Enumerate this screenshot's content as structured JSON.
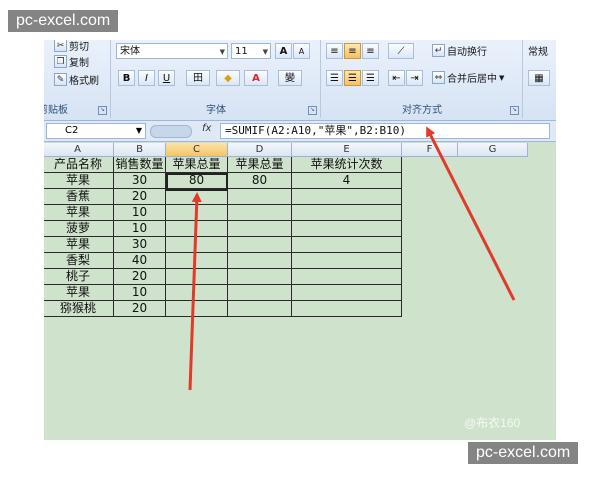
{
  "watermark": "pc-excel.com",
  "credit": "@布衣160",
  "ribbon": {
    "clipboard": {
      "cut": "剪切",
      "copy": "复制",
      "format_painter": "格式刷",
      "label": "剪贴板"
    },
    "font": {
      "name": "宋体",
      "size": "11",
      "grow": "A",
      "shrink": "A",
      "bold": "B",
      "italic": "I",
      "underline": "U",
      "border_icon": "田",
      "fill_icon": "◆",
      "color_icon": "A",
      "phonetic": "變",
      "label": "字体"
    },
    "alignment": {
      "wrap_text": "自动换行",
      "merge_center": "合并后居中",
      "label": "对齐方式"
    },
    "number": {
      "format": "常规"
    }
  },
  "formula_bar": {
    "name_box": "C2",
    "fx": "fx",
    "formula": "=SUMIF(A2:A10,\"苹果\",B2:B10)"
  },
  "columns": [
    "A",
    "B",
    "C",
    "D",
    "E",
    "F",
    "G"
  ],
  "table": {
    "headers": [
      "产品名称",
      "销售数量",
      "苹果总量",
      "苹果总量",
      "苹果统计次数"
    ],
    "rows": [
      [
        "苹果",
        "30",
        "80",
        "80",
        "4"
      ],
      [
        "香蕉",
        "20",
        "",
        "",
        ""
      ],
      [
        "苹果",
        "10",
        "",
        "",
        ""
      ],
      [
        "菠萝",
        "10",
        "",
        "",
        ""
      ],
      [
        "苹果",
        "30",
        "",
        "",
        ""
      ],
      [
        "香梨",
        "40",
        "",
        "",
        ""
      ],
      [
        "桃子",
        "20",
        "",
        "",
        ""
      ],
      [
        "苹果",
        "10",
        "",
        "",
        ""
      ],
      [
        "猕猴桃",
        "20",
        "",
        "",
        ""
      ]
    ]
  },
  "colors": {
    "accent_arrow": "#e03a2a",
    "sheet_bg": "#cfe3cc",
    "selected_header": "#f4c466"
  }
}
